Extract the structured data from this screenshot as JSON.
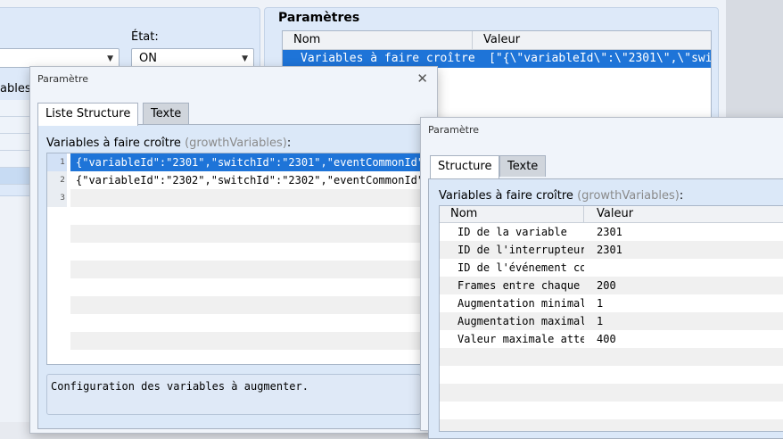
{
  "main": {
    "etat_label": "État:",
    "etat_value": "ON",
    "partial_label": "ables",
    "params_title": "Paramètres",
    "params_col_name": "Nom",
    "params_col_value": "Valeur",
    "params_row_name": "Variables à faire croître",
    "params_row_value": "[\"{\\\"variableId\\\":\\\"2301\\\",\\\"switc…"
  },
  "dialog1": {
    "title": "Paramètre",
    "tab_active": "Liste Structure",
    "tab_other": "Texte",
    "section_label": "Variables à faire croître",
    "section_key": "(growthVariables)",
    "section_colon": ":",
    "rows": [
      {
        "num": "1",
        "text": "{\"variableId\":\"2301\",\"switchId\":\"2301\",\"eventCommonId\":…"
      },
      {
        "num": "2",
        "text": "{\"variableId\":\"2302\",\"switchId\":\"2302\",\"eventCommonId\":…"
      },
      {
        "num": "3",
        "text": ""
      }
    ],
    "description": "Configuration des variables à augmenter."
  },
  "dialog2": {
    "title": "Paramètre",
    "tab_active": "Structure",
    "tab_other": "Texte",
    "section_label": "Variables à faire croître",
    "section_key": "(growthVariables)",
    "section_colon": ":",
    "col_name": "Nom",
    "col_value": "Valeur",
    "rows": [
      {
        "name": "ID de la variable",
        "value": "2301"
      },
      {
        "name": "ID de l'interrupteur…",
        "value": "2301"
      },
      {
        "name": "ID de l'événement co…",
        "value": ""
      },
      {
        "name": "Frames entre chaque …",
        "value": "200"
      },
      {
        "name": "Augmentation minimale",
        "value": "1"
      },
      {
        "name": "Augmentation maximale",
        "value": "1"
      },
      {
        "name": "Valeur maximale atte…",
        "value": "400"
      }
    ]
  },
  "colors": {
    "selection": "#1e74d8",
    "panel": "#dde9f9"
  }
}
